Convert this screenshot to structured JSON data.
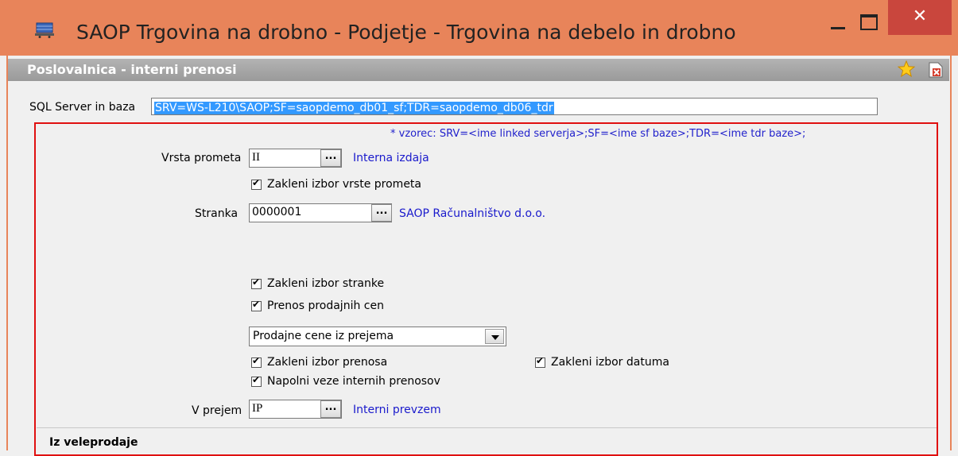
{
  "window": {
    "title": "SAOP Trgovina na drobno - Podjetje - Trgovina na debelo in drobno",
    "close_glyph": "✕"
  },
  "panel": {
    "title": "Poslovalnica - interni prenosi"
  },
  "sql": {
    "label": "SQL Server in baza",
    "value": "SRV=WS-L210\\SAOP;SF=saopdemo_db01_sf;TDR=saopdemo_db06_tdr",
    "hint": "* vzorec: SRV=<ime linked serverja>;SF=<ime sf baze>;TDR=<ime tdr baze>;"
  },
  "vrsta_prometa": {
    "label": "Vrsta prometa",
    "value": "II",
    "button": "...",
    "description": "Interna izdaja"
  },
  "lock_vrsta": {
    "label": "Zakleni izbor vrste prometa",
    "checked": true
  },
  "stranka": {
    "label": "Stranka",
    "value": "0000001",
    "button": "...",
    "description": "SAOP Računalništvo d.o.o."
  },
  "lock_stranka": {
    "label": "Zakleni izbor stranke",
    "checked": true
  },
  "prenos_cen": {
    "label": "Prenos prodajnih cen",
    "checked": true
  },
  "cene_select": {
    "selected": "Prodajne cene iz prejema"
  },
  "lock_prenosa": {
    "label": "Zakleni izbor prenosa",
    "checked": true
  },
  "lock_datuma": {
    "label": "Zakleni izbor datuma",
    "checked": true
  },
  "napolni_veze": {
    "label": "Napolni veze internih prenosov",
    "checked": true
  },
  "v_prejem": {
    "label": "V prejem",
    "value": "IP",
    "button": "...",
    "description": "Interni prevzem"
  },
  "section": {
    "title": "Iz veleprodaje"
  },
  "colors": {
    "titlebar": "#e8845a",
    "close": "#c9463d",
    "highlight": "#3399ff",
    "link": "#1a1acc",
    "red_box": "#e01010"
  },
  "icons": [
    "app-cart-icon",
    "minimize-icon",
    "maximize-icon",
    "close-icon",
    "favorite-star-icon",
    "close-document-icon"
  ]
}
